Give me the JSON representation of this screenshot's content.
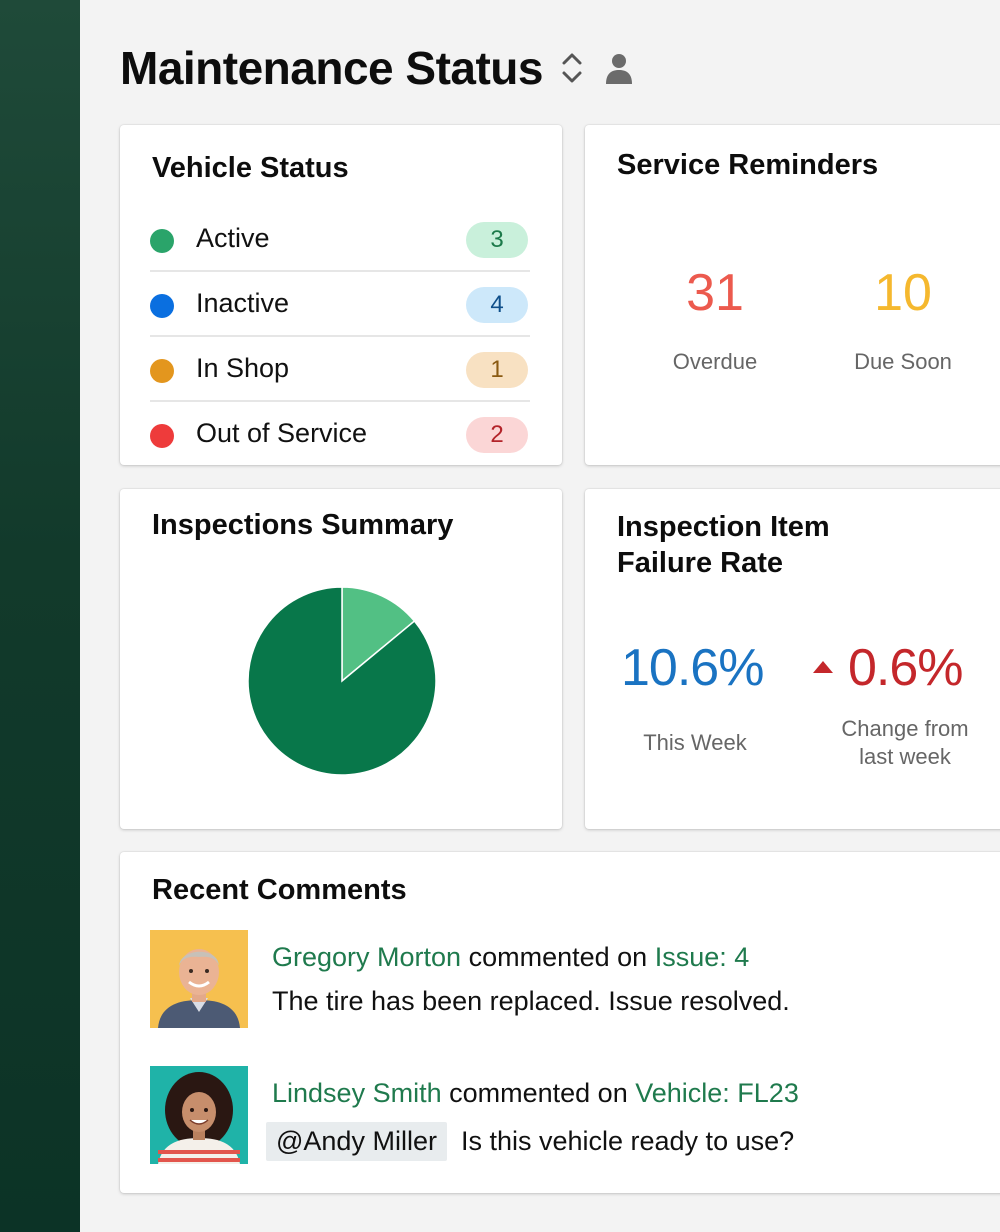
{
  "page": {
    "title": "Maintenance Status"
  },
  "vehicle_status": {
    "title": "Vehicle Status",
    "items": [
      {
        "label": "Active",
        "count": "3",
        "dot_color": "#2aa46a",
        "badge_bg": "#c9f0db",
        "badge_fg": "#1c7a4a"
      },
      {
        "label": "Inactive",
        "count": "4",
        "dot_color": "#0a6fe0",
        "badge_bg": "#cde8fa",
        "badge_fg": "#0f4f8a"
      },
      {
        "label": "In Shop",
        "count": "1",
        "dot_color": "#e3961e",
        "badge_bg": "#f8e1c2",
        "badge_fg": "#8a5a12"
      },
      {
        "label": "Out of Service",
        "count": "2",
        "dot_color": "#ee3b3b",
        "badge_bg": "#fbd6d6",
        "badge_fg": "#b3242a"
      }
    ]
  },
  "service_reminders": {
    "title": "Service Reminders",
    "overdue": {
      "value": "31",
      "label": "Overdue",
      "color": "#ec5a4e"
    },
    "due_soon": {
      "value": "10",
      "label": "Due Soon",
      "color": "#f5b82e"
    }
  },
  "inspections_summary": {
    "title": "Inspections Summary",
    "chart_data": {
      "type": "pie",
      "values": [
        86,
        14
      ],
      "colors": [
        "#08774a",
        "#52c084"
      ],
      "title": "",
      "legend": "none"
    }
  },
  "failure_rate": {
    "title_line1": "Inspection Item",
    "title_line2": "Failure Rate",
    "this_week": {
      "value": "10.6%",
      "label": "This Week"
    },
    "change": {
      "value": "0.6%",
      "label_line1": "Change from",
      "label_line2": "last week",
      "direction": "up"
    }
  },
  "recent_comments": {
    "title": "Recent Comments",
    "items": [
      {
        "author": "Gregory Morton",
        "action": "commented on",
        "target": "Issue: 4",
        "mention": "",
        "text": "The tire has been replaced. Issue resolved."
      },
      {
        "author": "Lindsey Smith",
        "action": "commented on",
        "target": "Vehicle: FL23",
        "mention": "@Andy Miller",
        "text": "Is this vehicle ready to use?"
      }
    ]
  }
}
